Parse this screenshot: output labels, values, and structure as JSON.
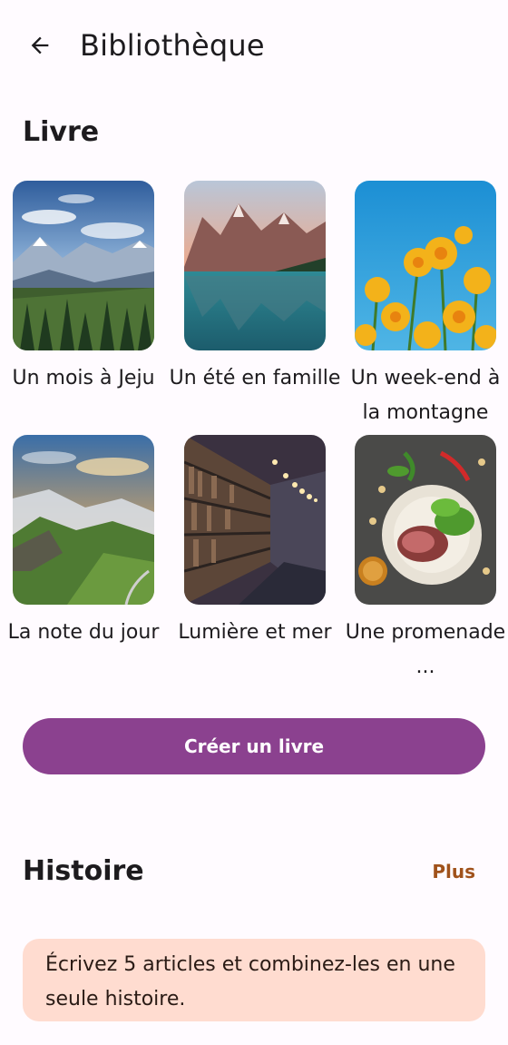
{
  "header": {
    "title": "Bibliothèque",
    "back_icon": "arrow-left-icon"
  },
  "books_section": {
    "title": "Livre",
    "books": [
      {
        "label": "Un mois à Jeju",
        "image": "mountain-forest-landscape"
      },
      {
        "label": "Un été en famille",
        "image": "mountain-lake-reflection"
      },
      {
        "label": "Un week-end à la montagne",
        "image": "yellow-flowers-blue-sky"
      },
      {
        "label": "La note du jour",
        "image": "green-hills-sunset"
      },
      {
        "label": "Lumière et mer",
        "image": "library-bookshelves"
      },
      {
        "label": "Une promenade ...",
        "image": "steak-salad-plate"
      }
    ],
    "create_label": "Créer un livre"
  },
  "story_section": {
    "title": "Histoire",
    "more_label": "Plus",
    "card_text": "Écrivez 5 articles et combinez-les en une seule histoire."
  },
  "colors": {
    "background": "#fffbff",
    "primary": "#8b418f",
    "accent_link": "#a0521b",
    "card_bg": "#ffdcd0"
  }
}
